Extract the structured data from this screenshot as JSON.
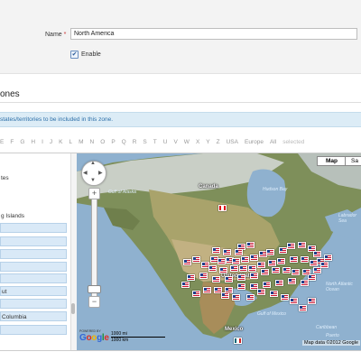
{
  "form": {
    "name_label": "Name",
    "required_mark": "*",
    "name_value": "North America",
    "enable_label": "Enable",
    "enable_checked_glyph": "✔"
  },
  "section": {
    "title": "ones",
    "info": "states/territories to be included in this zone."
  },
  "filter_letters": [
    "E",
    "F",
    "G",
    "H",
    "I",
    "J",
    "K",
    "L",
    "M",
    "N",
    "O",
    "P",
    "Q",
    "R",
    "S",
    "T",
    "U",
    "V",
    "W",
    "X",
    "Y",
    "Z",
    "USA",
    "Europe",
    "All",
    "selected"
  ],
  "sidebar": {
    "items": [
      {
        "label": "tes",
        "boxed": false
      },
      {
        "label": "g Islands",
        "boxed": false
      },
      {
        "label": "",
        "boxed": true
      },
      {
        "label": "",
        "boxed": true
      },
      {
        "label": "",
        "boxed": true
      },
      {
        "label": "",
        "boxed": true
      },
      {
        "label": "",
        "boxed": true
      },
      {
        "label": "ut",
        "boxed": true
      },
      {
        "label": "",
        "boxed": true
      },
      {
        "label": "Columbia",
        "boxed": true
      },
      {
        "label": "",
        "boxed": true
      }
    ]
  },
  "map": {
    "type_buttons": [
      "Map",
      "Sa"
    ],
    "labels": {
      "canada": "Canada",
      "united_states": "United States",
      "mexico": "Mexico",
      "gulf_alaska": "Gulf of Alaska",
      "hudson_bay": "Hudson Bay",
      "labrador_sea": "Labrador Sea",
      "gulf_mexico": "Gulf of Mexico",
      "caribbean": "Caribbean",
      "puerto_rico": "Puerto",
      "north_atlantic": "North Atlantic Ocean",
      "powered_by": "POWERED BY",
      "google": "Google",
      "scale_mi": "1000 mi",
      "scale_km": "1000 km",
      "map_data": "Map data ©2012 Google"
    }
  },
  "colors": {
    "info_bg": "#dcecf6",
    "info_text": "#2d6fa8",
    "sidebar_box": "#d9e9f7",
    "water": "#8fb1cf"
  }
}
